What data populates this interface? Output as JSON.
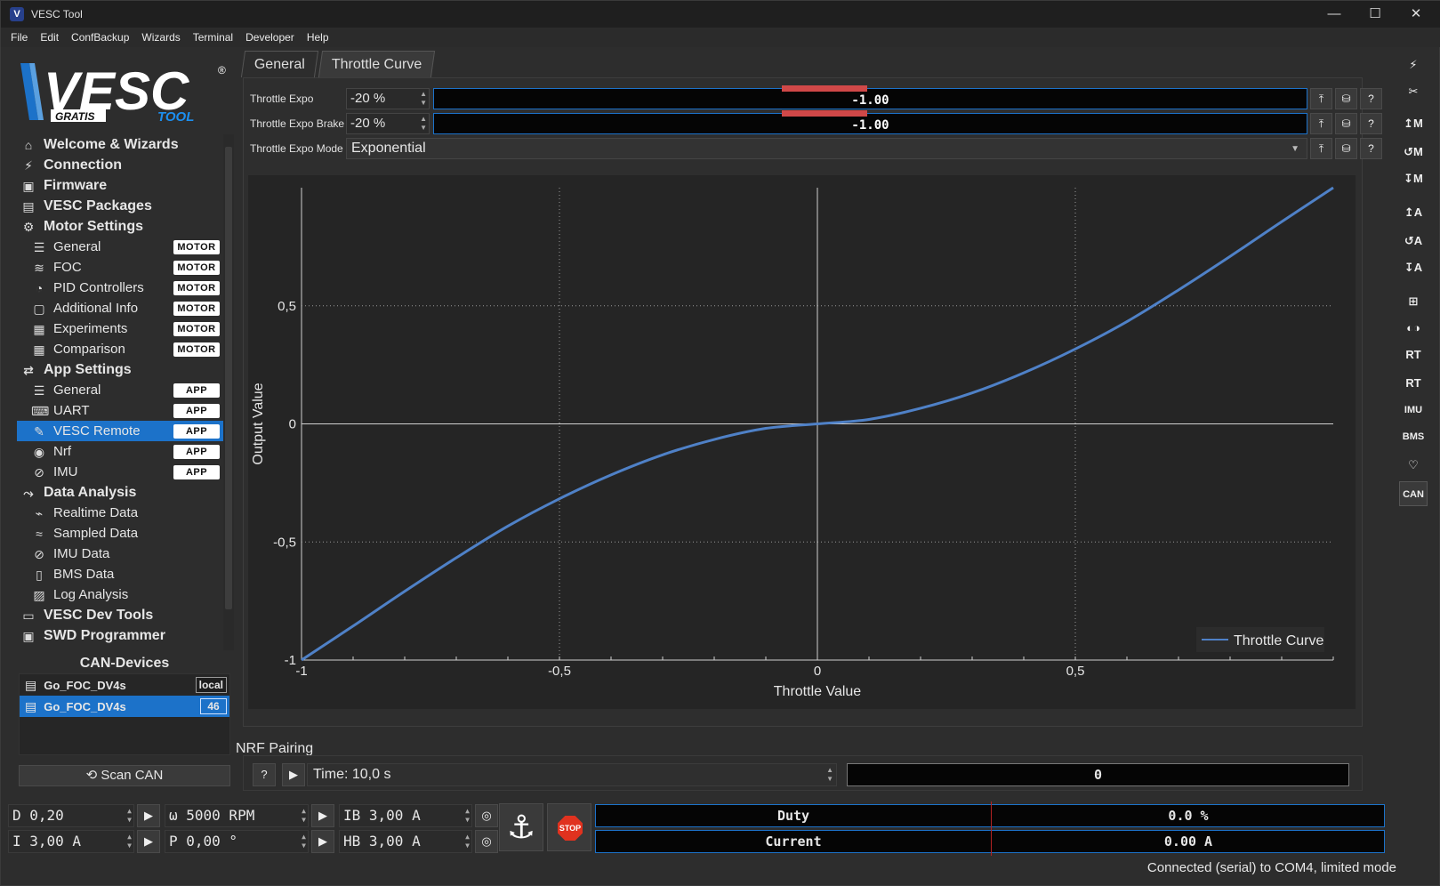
{
  "window": {
    "title": "VESC Tool",
    "minimize": "—",
    "maximize": "☐",
    "close": "✕"
  },
  "menu": [
    "File",
    "Edit",
    "ConfBackup",
    "Wizards",
    "Terminal",
    "Developer",
    "Help"
  ],
  "logo": {
    "brand": "VESC",
    "reg": "®",
    "gratis": "GRATIS",
    "tool": "TOOL"
  },
  "nav": [
    {
      "label": "Welcome & Wizards",
      "level": "top",
      "icon": "home-icon",
      "glyph": "⌂"
    },
    {
      "label": "Connection",
      "level": "top",
      "icon": "plug-icon",
      "glyph": "⚡"
    },
    {
      "label": "Firmware",
      "level": "top",
      "icon": "chip-icon",
      "glyph": "▣"
    },
    {
      "label": "VESC Packages",
      "level": "top",
      "icon": "package-icon",
      "glyph": "▤"
    },
    {
      "label": "Motor Settings",
      "level": "top",
      "icon": "motor-icon",
      "glyph": "⚙"
    },
    {
      "label": "General",
      "level": "sub",
      "icon": "sliders-icon",
      "glyph": "☰",
      "tag": "MOTOR"
    },
    {
      "label": "FOC",
      "level": "sub",
      "icon": "foc-icon",
      "glyph": "≋",
      "tag": "MOTOR"
    },
    {
      "label": "PID Controllers",
      "level": "sub",
      "icon": "gauge-icon",
      "glyph": "◔",
      "tag": "MOTOR"
    },
    {
      "label": "Additional Info",
      "level": "sub",
      "icon": "info-icon",
      "glyph": "▢",
      "tag": "MOTOR"
    },
    {
      "label": "Experiments",
      "level": "sub",
      "icon": "calculator-icon",
      "glyph": "▦",
      "tag": "MOTOR"
    },
    {
      "label": "Comparison",
      "level": "sub",
      "icon": "calculator-icon",
      "glyph": "▦",
      "tag": "MOTOR"
    },
    {
      "label": "App Settings",
      "level": "top",
      "icon": "app-settings-icon",
      "glyph": "⇄"
    },
    {
      "label": "General",
      "level": "sub",
      "icon": "sliders-icon",
      "glyph": "☰",
      "tag": "APP"
    },
    {
      "label": "UART",
      "level": "sub",
      "icon": "keyboard-icon",
      "glyph": "⌨",
      "tag": "APP"
    },
    {
      "label": "VESC Remote",
      "level": "sub",
      "icon": "remote-icon",
      "glyph": "✎",
      "tag": "APP",
      "selected": true
    },
    {
      "label": "Nrf",
      "level": "sub",
      "icon": "radio-icon",
      "glyph": "◉",
      "tag": "APP"
    },
    {
      "label": "IMU",
      "level": "sub",
      "icon": "imu-icon",
      "glyph": "⊘",
      "tag": "APP"
    },
    {
      "label": "Data Analysis",
      "level": "top",
      "icon": "analysis-icon",
      "glyph": "⤳"
    },
    {
      "label": "Realtime Data",
      "level": "sub",
      "icon": "realtime-icon",
      "glyph": "⌁"
    },
    {
      "label": "Sampled Data",
      "level": "sub",
      "icon": "sampled-icon",
      "glyph": "≈"
    },
    {
      "label": "IMU Data",
      "level": "sub",
      "icon": "imu-icon",
      "glyph": "⊘"
    },
    {
      "label": "BMS Data",
      "level": "sub",
      "icon": "battery-icon",
      "glyph": "▯"
    },
    {
      "label": "Log Analysis",
      "level": "sub",
      "icon": "log-icon",
      "glyph": "▨"
    },
    {
      "label": "VESC Dev Tools",
      "level": "top",
      "icon": "terminal-icon",
      "glyph": "▭"
    },
    {
      "label": "SWD Programmer",
      "level": "top",
      "icon": "chip-icon",
      "glyph": "▣"
    }
  ],
  "can": {
    "title": "CAN-Devices",
    "devices": [
      {
        "name": "Go_FOC_DV4s",
        "id": "local",
        "selected": false
      },
      {
        "name": "Go_FOC_DV4s",
        "id": "46",
        "selected": true
      }
    ],
    "scan_label": "⟲ Scan CAN"
  },
  "tabs": [
    {
      "label": "General",
      "active": false
    },
    {
      "label": "Throttle Curve",
      "active": true
    }
  ],
  "params": {
    "expo": {
      "label": "Throttle Expo",
      "value": "-20 %",
      "bar": "-1.00"
    },
    "expo_brake": {
      "label": "Throttle Expo Brake",
      "value": "-20 %",
      "bar": "-1.00"
    },
    "mode": {
      "label": "Throttle Expo Mode",
      "value": "Exponential"
    }
  },
  "chart_data": {
    "type": "line",
    "xlabel": "Throttle Value",
    "ylabel": "Output Value",
    "xlim": [
      -1,
      1
    ],
    "ylim": [
      -1,
      1
    ],
    "xticks": [
      "-1",
      "-0,5",
      "0",
      "0,5"
    ],
    "yticks": [
      "-1",
      "-0,5",
      "0",
      "0,5"
    ],
    "grid": true,
    "legend_position": "bottom-right",
    "series": [
      {
        "name": "Throttle Curve",
        "color": "#4f81c7",
        "x": [
          -1,
          -0.9,
          -0.8,
          -0.7,
          -0.6,
          -0.5,
          -0.4,
          -0.3,
          -0.2,
          -0.1,
          0,
          0.1,
          0.2,
          0.3,
          0.4,
          0.5,
          0.6,
          0.7,
          0.8,
          0.9,
          1
        ],
        "y": [
          -1,
          -0.856,
          -0.709,
          -0.567,
          -0.433,
          -0.317,
          -0.216,
          -0.131,
          -0.066,
          -0.019,
          0,
          0.019,
          0.066,
          0.131,
          0.216,
          0.317,
          0.433,
          0.567,
          0.709,
          0.856,
          1
        ]
      }
    ]
  },
  "nrf": {
    "title": "NRF Pairing",
    "time": "Time: 10,0 s",
    "result": "0"
  },
  "controls": {
    "duty": "D 0,20",
    "current": "I 3,00 A",
    "rpm": "ω 5000 RPM",
    "pos": "P 0,00 °",
    "ib": "IB 3,00 A",
    "hb": "HB 3,00 A",
    "stop_label": "STOP"
  },
  "gauges": {
    "duty": {
      "label": "Duty",
      "value": "0.0 %"
    },
    "current": {
      "label": "Current",
      "value": "0.00 A"
    }
  },
  "status": "Connected (serial) to COM4, limited mode",
  "right_toolbar": [
    {
      "name": "connect-icon",
      "glyph": "⚡"
    },
    {
      "name": "disconnect-icon",
      "glyph": "✂"
    },
    {
      "name": "read-motor-config-icon",
      "glyph": "↥M"
    },
    {
      "name": "read-default-motor-config-icon",
      "glyph": "↺M"
    },
    {
      "name": "write-motor-config-icon",
      "glyph": "↧M"
    },
    {
      "name": "read-app-config-icon",
      "glyph": "↥A"
    },
    {
      "name": "read-default-app-config-icon",
      "glyph": "↺A"
    },
    {
      "name": "write-app-config-icon",
      "glyph": "↧A"
    },
    {
      "name": "can-fwd-icon",
      "glyph": "⊞"
    },
    {
      "name": "gamepad-icon",
      "glyph": "◐◑"
    },
    {
      "name": "rt-data-icon",
      "glyph": "RT"
    },
    {
      "name": "rt-app-icon",
      "glyph": "RT"
    },
    {
      "name": "imu-stream-icon",
      "glyph": "IMU"
    },
    {
      "name": "bms-stream-icon",
      "glyph": "BMS"
    },
    {
      "name": "heartbeat-icon",
      "glyph": "♡"
    },
    {
      "name": "can-icon",
      "glyph": "CAN"
    }
  ]
}
